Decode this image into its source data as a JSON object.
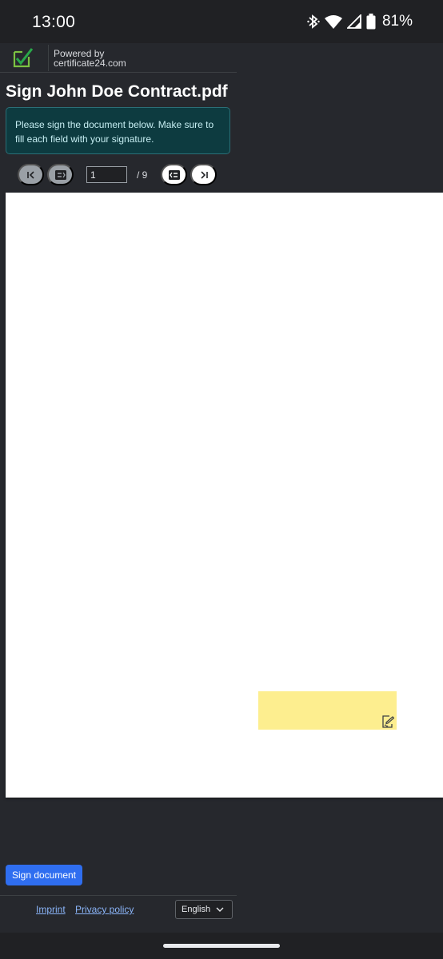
{
  "status_bar": {
    "time": "13:00",
    "battery_percent": "81%",
    "icons": [
      "bluetooth-icon",
      "wifi-icon",
      "cell-signal-icon",
      "battery-icon"
    ]
  },
  "brand": {
    "logo": "certificate-check-icon",
    "powered_by": "Powered by",
    "domain": "certificate24.com"
  },
  "document": {
    "title": "Sign John Doe Contract.pdf",
    "instructions": "Please sign the document below. Make sure to fill each field with your signature."
  },
  "pager": {
    "current_page": "1",
    "total_pages": "/ 9",
    "buttons": [
      "first-page",
      "previous-field",
      "next-field",
      "last-page"
    ]
  },
  "signature_field": {
    "icon": "signature-pen-icon",
    "color": "#fdee8f"
  },
  "actions": {
    "sign_label": "Sign document",
    "accent_color": "#2f6ef0"
  },
  "footer": {
    "imprint": "Imprint",
    "privacy": "Privacy policy",
    "language": "English"
  }
}
